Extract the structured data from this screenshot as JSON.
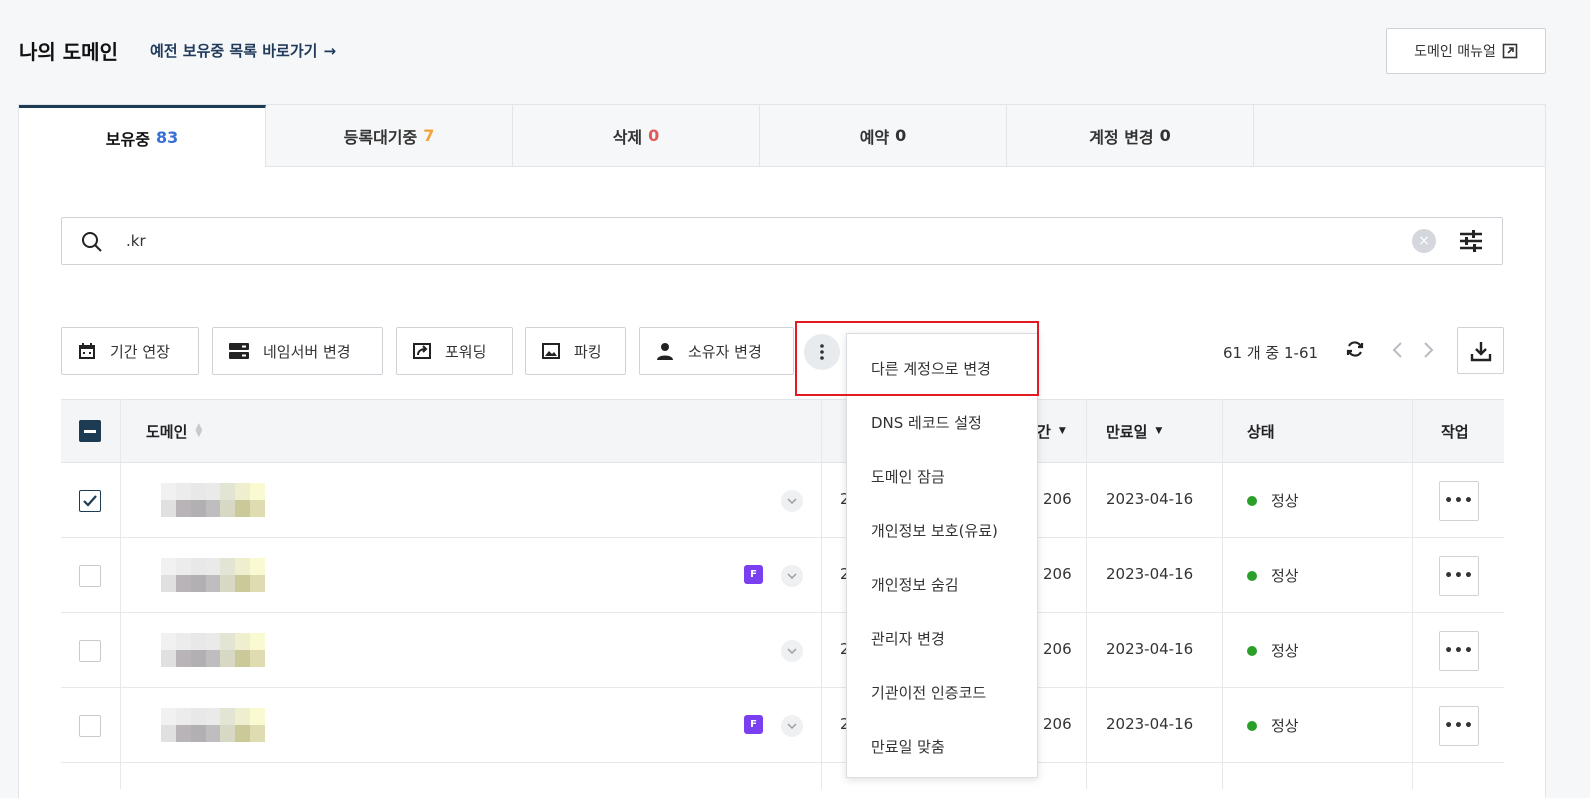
{
  "header": {
    "title": "나의 도메인",
    "old_list_link": "예전 보유중 목록 바로가기",
    "old_list_arrow": "→",
    "manual_button": "도메인 매뉴얼"
  },
  "tabs": [
    {
      "label": "보유중",
      "count": "83",
      "count_color": "#3b6fd8"
    },
    {
      "label": "등록대기중",
      "count": "7",
      "count_color": "#f2a33a"
    },
    {
      "label": "삭제",
      "count": "0",
      "count_color": "#e05a5a"
    },
    {
      "label": "예약",
      "count": "0",
      "count_color": "#333333"
    },
    {
      "label": "계정 변경",
      "count": "0",
      "count_color": "#333333"
    }
  ],
  "search": {
    "value": ".kr",
    "clear_icon": "×"
  },
  "actions": {
    "extend": "기간 연장",
    "nameserver": "네임서버 변경",
    "forwarding": "포워딩",
    "parking": "파킹",
    "owner": "소유자 변경"
  },
  "pager": {
    "count_text": "61 개 중 1-61"
  },
  "table": {
    "headers": {
      "domain": "도메인",
      "period_partial": "간",
      "expiry": "만료일",
      "status": "상태",
      "job": "작업"
    },
    "rows": [
      {
        "checked": true,
        "f_badge": false,
        "partial": "2",
        "period": "206",
        "expiry": "2023-04-16",
        "status": "정상"
      },
      {
        "checked": false,
        "f_badge": true,
        "partial": "2",
        "period": "206",
        "expiry": "2023-04-16",
        "status": "정상"
      },
      {
        "checked": false,
        "f_badge": false,
        "partial": "2",
        "period": "206",
        "expiry": "2023-04-16",
        "status": "정상"
      },
      {
        "checked": false,
        "f_badge": true,
        "partial": "2",
        "period": "206",
        "expiry": "2023-04-16",
        "status": "정상"
      }
    ],
    "f_badge_label": "F",
    "job_label": "•••"
  },
  "dropdown": {
    "items": [
      "다른 계정으로 변경",
      "DNS 레코드 설정",
      "도메인 잠금",
      "개인정보 보호(유료)",
      "개인정보 숨김",
      "관리자 변경",
      "기관이전 인증코드",
      "만료일 맞춤"
    ]
  },
  "colors": {
    "accent": "#1d3b52",
    "highlight": "#e21b23",
    "status_ok": "#2aa02a",
    "badge": "#7b3ff2"
  }
}
